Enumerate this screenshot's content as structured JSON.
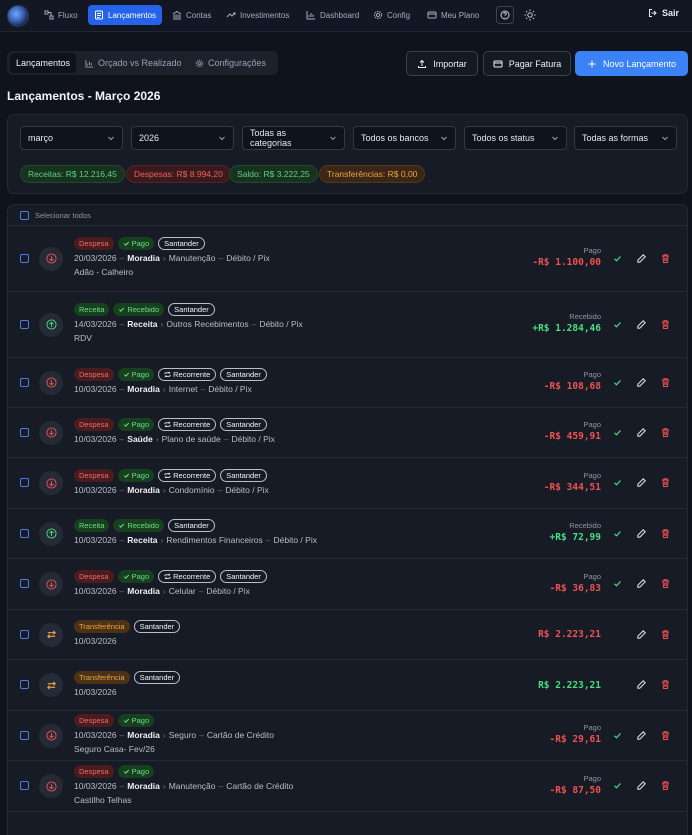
{
  "nav": {
    "items": [
      {
        "label": "Fluxo",
        "icon": "flow-icon"
      },
      {
        "label": "Lançamentos",
        "icon": "list-icon",
        "active": true
      },
      {
        "label": "Contas",
        "icon": "bank-icon"
      },
      {
        "label": "Investimentos",
        "icon": "trend-icon"
      },
      {
        "label": "Dashboard",
        "icon": "chart-icon"
      },
      {
        "label": "Config",
        "icon": "gear-icon"
      },
      {
        "label": "Meu Plano",
        "icon": "card-icon"
      }
    ],
    "logout_label": "Sair"
  },
  "tabs": {
    "items": [
      "Lançamentos",
      "Orçado vs Realizado",
      "Configurações"
    ]
  },
  "actions": {
    "import_label": "Importar",
    "pay_label": "Pagar Fatura",
    "new_label": "Novo Lançamento"
  },
  "page_title": "Lançamentos - Março 2026",
  "filters": {
    "month": "março",
    "year": "2026",
    "category": "Todas as categorias",
    "bank": "Todos os bancos",
    "status": "Todos os status",
    "payment": "Todas as formas"
  },
  "summary": {
    "receitas": "Receitas: R$ 12.216,45",
    "despesas": "Despesas: R$ 8.994,20",
    "saldo": "Saldo: R$ 3.222,25",
    "transferencias": "Transferências: R$ 0,00"
  },
  "select_all_label": "Selecionar todos",
  "colors": {
    "accent": "#3b82f6",
    "expense": "#f05252",
    "income": "#4ade80",
    "transfer": "#f0a346"
  },
  "transactions": [
    {
      "kind": "expense",
      "type": "Despesa",
      "status": "Pago",
      "recurring": "",
      "bank": "Santander",
      "date": "20/03/2026",
      "category": "Moradia",
      "subcategory": "Manutenção",
      "payment": "Débito / Pix",
      "description": "Adão - Calheiro",
      "status_label": "Pago",
      "amount": "-R$ 1.100,00"
    },
    {
      "kind": "income",
      "type": "Receita",
      "status": "Recebido",
      "recurring": "",
      "bank": "Santander",
      "date": "14/03/2026",
      "category": "Receita",
      "subcategory": "Outros Recebimentos",
      "payment": "Débito / Pix",
      "description": "RDV",
      "status_label": "Recebido",
      "amount": "+R$ 1.284,46"
    },
    {
      "kind": "expense",
      "type": "Despesa",
      "status": "Pago",
      "recurring": "Recorrente",
      "bank": "Santander",
      "date": "10/03/2026",
      "category": "Moradia",
      "subcategory": "Internet",
      "payment": "Débito / Pix",
      "description": "",
      "status_label": "Pago",
      "amount": "-R$ 108,68"
    },
    {
      "kind": "expense",
      "type": "Despesa",
      "status": "Pago",
      "recurring": "Recorrente",
      "bank": "Santander",
      "date": "10/03/2026",
      "category": "Saúde",
      "subcategory": "Plano de saúde",
      "payment": "Débito / Pix",
      "description": "",
      "status_label": "Pago",
      "amount": "-R$ 459,91"
    },
    {
      "kind": "expense",
      "type": "Despesa",
      "status": "Pago",
      "recurring": "Recorrente",
      "bank": "Santander",
      "date": "10/03/2026",
      "category": "Moradia",
      "subcategory": "Condomínio",
      "payment": "Débito / Pix",
      "description": "",
      "status_label": "Pago",
      "amount": "-R$ 344,51"
    },
    {
      "kind": "income",
      "type": "Receita",
      "status": "Recebido",
      "recurring": "",
      "bank": "Santander",
      "date": "10/03/2026",
      "category": "Receita",
      "subcategory": "Rendimentos Financeiros",
      "payment": "Débito / Pix",
      "description": "",
      "status_label": "Recebido",
      "amount": "+R$ 72,99"
    },
    {
      "kind": "expense",
      "type": "Despesa",
      "status": "Pago",
      "recurring": "Recorrente",
      "bank": "Santander",
      "date": "10/03/2026",
      "category": "Moradia",
      "subcategory": "Celular",
      "payment": "Débito / Pix",
      "description": "",
      "status_label": "Pago",
      "amount": "-R$ 36,83"
    },
    {
      "kind": "transfer-out",
      "type": "Transferência",
      "status": "",
      "recurring": "",
      "bank": "Santander",
      "date": "10/03/2026",
      "category": "",
      "subcategory": "",
      "payment": "",
      "description": "",
      "status_label": "",
      "amount": "R$ 2.223,21"
    },
    {
      "kind": "transfer-in",
      "type": "Transferência",
      "status": "",
      "recurring": "",
      "bank": "Santander",
      "date": "10/03/2026",
      "category": "",
      "subcategory": "",
      "payment": "",
      "description": "",
      "status_label": "",
      "amount": "R$ 2.223,21"
    },
    {
      "kind": "expense",
      "type": "Despesa",
      "status": "Pago",
      "recurring": "",
      "bank": "",
      "date": "10/03/2026",
      "category": "Moradia",
      "subcategory": "Seguro",
      "payment": "Cartão de Crédito",
      "description": "Seguro Casa- Fev/26",
      "status_label": "Pago",
      "amount": "-R$ 29,61"
    },
    {
      "kind": "expense",
      "type": "Despesa",
      "status": "Pago",
      "recurring": "",
      "bank": "",
      "date": "10/03/2026",
      "category": "Moradia",
      "subcategory": "Manutenção",
      "payment": "Cartão de Crédito",
      "description": "Castilho Telhas",
      "status_label": "Pago",
      "amount": "-R$ 87,50"
    }
  ]
}
